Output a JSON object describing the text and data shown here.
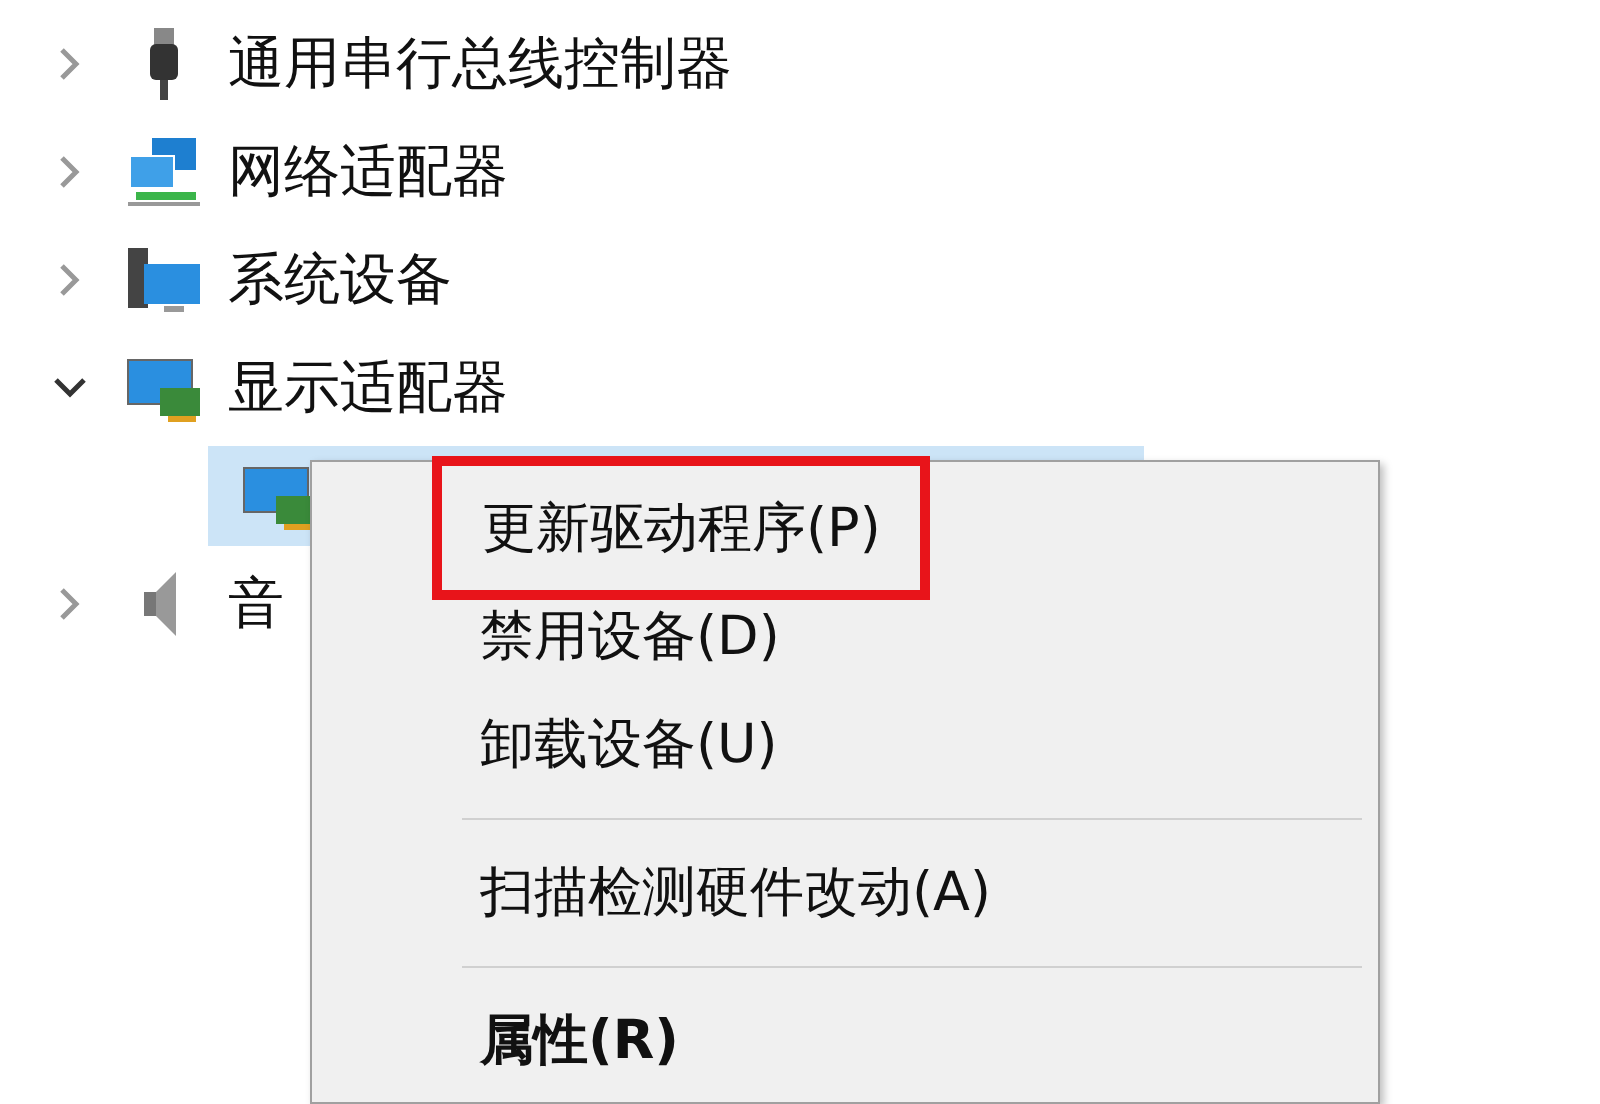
{
  "tree": {
    "items": [
      {
        "label": "通用串行总线控制器",
        "kind": "usb",
        "expanded": false
      },
      {
        "label": "网络适配器",
        "kind": "network",
        "expanded": false
      },
      {
        "label": "系统设备",
        "kind": "system",
        "expanded": false
      },
      {
        "label": "显示适配器",
        "kind": "display",
        "expanded": true,
        "children": [
          {
            "kind": "display",
            "selected": true
          }
        ]
      },
      {
        "label": "音",
        "kind": "speaker",
        "expanded": false
      }
    ]
  },
  "context_menu": {
    "items": [
      {
        "kind": "item",
        "label": "更新驱动程序(P)",
        "bold": false,
        "highlighted": true
      },
      {
        "kind": "item",
        "label": "禁用设备(D)",
        "bold": false,
        "highlighted": false
      },
      {
        "kind": "item",
        "label": "卸载设备(U)",
        "bold": false,
        "highlighted": false
      },
      {
        "kind": "separator"
      },
      {
        "kind": "item",
        "label": "扫描检测硬件改动(A)",
        "bold": false,
        "highlighted": false
      },
      {
        "kind": "separator"
      },
      {
        "kind": "item",
        "label": "属性(R)",
        "bold": true,
        "highlighted": false
      }
    ]
  }
}
